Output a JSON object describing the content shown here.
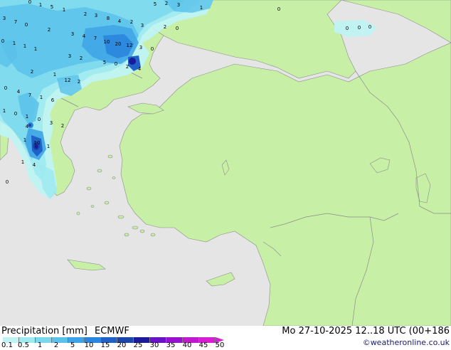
{
  "footer": {
    "title": "Precipitation [mm]",
    "model": "ECMWF",
    "run_info": "Mo 27-10-2025 12..18 UTC (00+186",
    "credit": "©weatheronline.co.uk"
  },
  "legend": {
    "ticks": [
      "0.1",
      "0.5",
      "1",
      "2",
      "5",
      "10",
      "15",
      "20",
      "25",
      "30",
      "35",
      "40",
      "45",
      "50"
    ],
    "colors": [
      "#bff3f3",
      "#9eeaf1",
      "#7ad8ee",
      "#59c1ea",
      "#3ea3e6",
      "#2a85dc",
      "#1e62c8",
      "#1946a8",
      "#1a1a9a",
      "#6a12c8",
      "#9a10d0",
      "#c018cc",
      "#d71cd2"
    ]
  },
  "map": {
    "colors": {
      "sea": "#e5e5e5",
      "land": "#c7f0a6",
      "border": "#8c8c8c"
    },
    "precip_values": [
      "0",
      "1",
      "5",
      "1",
      "2",
      "3",
      "8",
      "4",
      "2",
      "5",
      "2",
      "3",
      "1",
      "3",
      "7",
      "0",
      "2",
      "3",
      "4",
      "7",
      "10",
      "20",
      "12",
      "3",
      "0",
      "3",
      "2",
      "0",
      "0",
      "1",
      "1",
      "1",
      "3",
      "2",
      "5",
      "0",
      "2",
      "4",
      "2",
      "1",
      "12",
      "2",
      "0",
      "4",
      "7",
      "1",
      "6",
      "1",
      "0",
      "1",
      "0",
      "4",
      "3",
      "2",
      "1",
      "10",
      "1",
      "1",
      "4",
      "0",
      "0",
      "0",
      "0",
      "0"
    ]
  }
}
